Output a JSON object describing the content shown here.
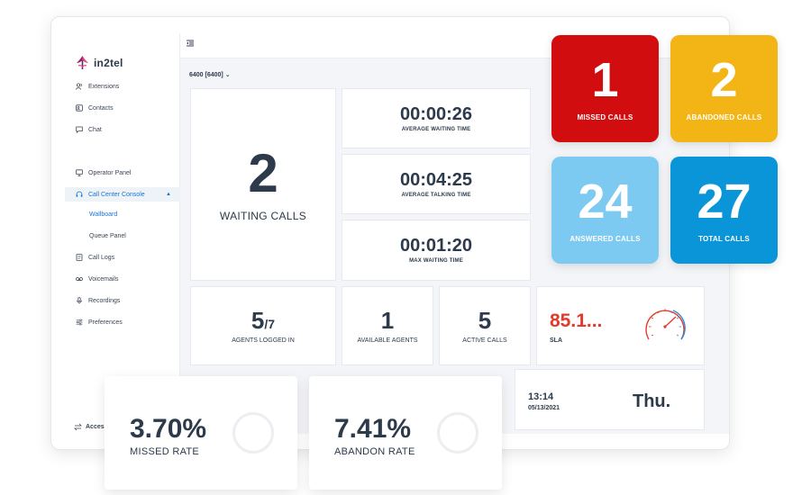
{
  "brand": {
    "name": "in2tel"
  },
  "sidebar": {
    "items": [
      {
        "label": "Extensions",
        "icon": "users-icon"
      },
      {
        "label": "Contacts",
        "icon": "contacts-icon"
      },
      {
        "label": "Chat",
        "icon": "chat-icon"
      },
      {
        "label": "Operator Panel",
        "icon": "monitor-icon"
      },
      {
        "label": "Call Center Console",
        "icon": "headset-icon"
      },
      {
        "label": "Call Logs",
        "icon": "call-logs-icon"
      },
      {
        "label": "Voicemails",
        "icon": "voicemail-icon"
      },
      {
        "label": "Recordings",
        "icon": "microphone-icon"
      },
      {
        "label": "Preferences",
        "icon": "sliders-icon"
      }
    ],
    "subitems": [
      {
        "label": "Wallboard"
      },
      {
        "label": "Queue Panel"
      }
    ],
    "bottom_label": "Acces"
  },
  "queue": {
    "selected": "6400 [6400]"
  },
  "waiting": {
    "value": "2",
    "label": "WAITING CALLS"
  },
  "times": [
    {
      "value": "00:00:26",
      "label": "AVERAGE WAITING TIME"
    },
    {
      "value": "00:04:25",
      "label": "AVERAGE TALKING TIME"
    },
    {
      "value": "00:01:20",
      "label": "MAX WAITING TIME"
    }
  ],
  "agents": {
    "logged": "5",
    "total": "/7",
    "label": "AGENTS LOGGED IN"
  },
  "available": {
    "value": "1",
    "label": "AVAILABLE AGENTS"
  },
  "active": {
    "value": "5",
    "label": "ACTIVE CALLS"
  },
  "sla": {
    "value": "85.1...",
    "label": "SLA"
  },
  "clock": {
    "time": "13:14",
    "date": "05/13/2021",
    "day": "Thu."
  },
  "tiles": [
    {
      "value": "1",
      "label": "MISSED CALLS",
      "color": "#d10d10"
    },
    {
      "value": "2",
      "label": "ABANDONED CALLS",
      "color": "#f3b416"
    },
    {
      "value": "24",
      "label": "ANSWERED CALLS",
      "color": "#7cc9f1"
    },
    {
      "value": "27",
      "label": "TOTAL CALLS",
      "color": "#0a95d8"
    }
  ],
  "rates": [
    {
      "value": "3.70%",
      "label": "MISSED RATE"
    },
    {
      "value": "7.41%",
      "label": "ABANDON RATE"
    }
  ]
}
